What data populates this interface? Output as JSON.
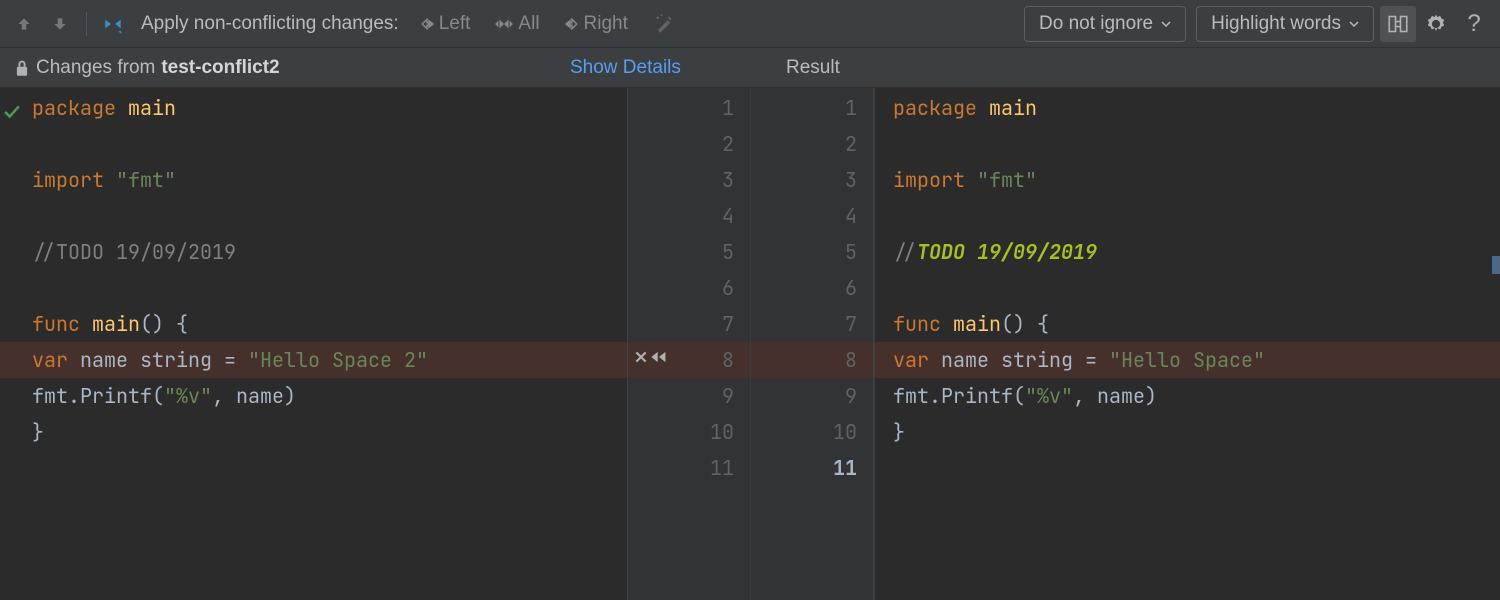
{
  "toolbar": {
    "apply_label": "Apply non-conflicting changes:",
    "left": "Left",
    "all": "All",
    "right": "Right",
    "dropdown1": "Do not ignore",
    "dropdown2": "Highlight words"
  },
  "tabs": {
    "changes_from_prefix": "Changes from ",
    "changes_from_branch": "test-conflict2",
    "show_details": "Show Details",
    "result": "Result"
  },
  "left_code": {
    "l1_kw": "package",
    "l1_id": " main",
    "l3_kw": "import",
    "l3_str": " \"fmt\"",
    "l5": "//TODO 19/09/2019",
    "l7_kw": "func",
    "l7_id": " main",
    "l7_rest": "() {",
    "l8_pad": "    ",
    "l8_kw": "var",
    "l8_name": " name ",
    "l8_type": "string",
    "l8_eq": " = ",
    "l8_str": "\"Hello Space 2\"",
    "l9_pad": "    ",
    "l9_call": "fmt.Printf(",
    "l9_str": "\"%v\"",
    "l9_rest": ", name)",
    "l10": "}"
  },
  "right_code": {
    "l1_kw": "package",
    "l1_id": " main",
    "l3_kw": "import",
    "l3_str": " \"fmt\"",
    "l5_pre": "//",
    "l5_todo": "TODO 19/09/2019",
    "l7_kw": "func",
    "l7_id": " main",
    "l7_rest": "() {",
    "l8_pad": "    ",
    "l8_kw": "var",
    "l8_name": " name ",
    "l8_type": "string",
    "l8_eq": " = ",
    "l8_str": "\"Hello Space\"",
    "l9_pad": "    ",
    "l9_call": "fmt.Printf(",
    "l9_str": "\"%v\"",
    "l9_rest": ", name)",
    "l10": "}"
  },
  "gutter": {
    "left": [
      "1",
      "2",
      "3",
      "4",
      "5",
      "6",
      "7",
      "8",
      "9",
      "10",
      "11"
    ],
    "right": [
      "1",
      "2",
      "3",
      "4",
      "5",
      "6",
      "7",
      "8",
      "9",
      "10",
      "11"
    ]
  }
}
